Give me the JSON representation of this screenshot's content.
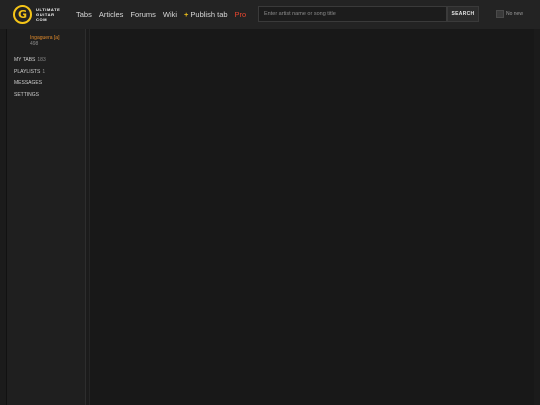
{
  "logo": {
    "mark": "G",
    "line1": "ULTIMATE",
    "line2": "GUITAR",
    "line3": "COM"
  },
  "nav": {
    "tabs": "Tabs",
    "articles": "Articles",
    "forums": "Forums",
    "wiki": "Wiki",
    "publish_plus": "+",
    "publish": "Publish tab",
    "pro": "Pro"
  },
  "search": {
    "placeholder": "Enter artist name or song title",
    "button": "SEARCH"
  },
  "no_new": "No new",
  "user": {
    "name": "Ingaguera [a]",
    "points": "498"
  },
  "sidebar": {
    "items": [
      {
        "label": "MY TABS",
        "count": "183"
      },
      {
        "label": "PLAYLISTS",
        "count": "1"
      },
      {
        "label": "MESSAGES",
        "count": ""
      },
      {
        "label": "SETTINGS",
        "count": ""
      }
    ]
  },
  "colors": {
    "accent": "#f5c518",
    "pro": "#e8462f",
    "username": "#e08a2b",
    "background": "#1b1b1b"
  }
}
